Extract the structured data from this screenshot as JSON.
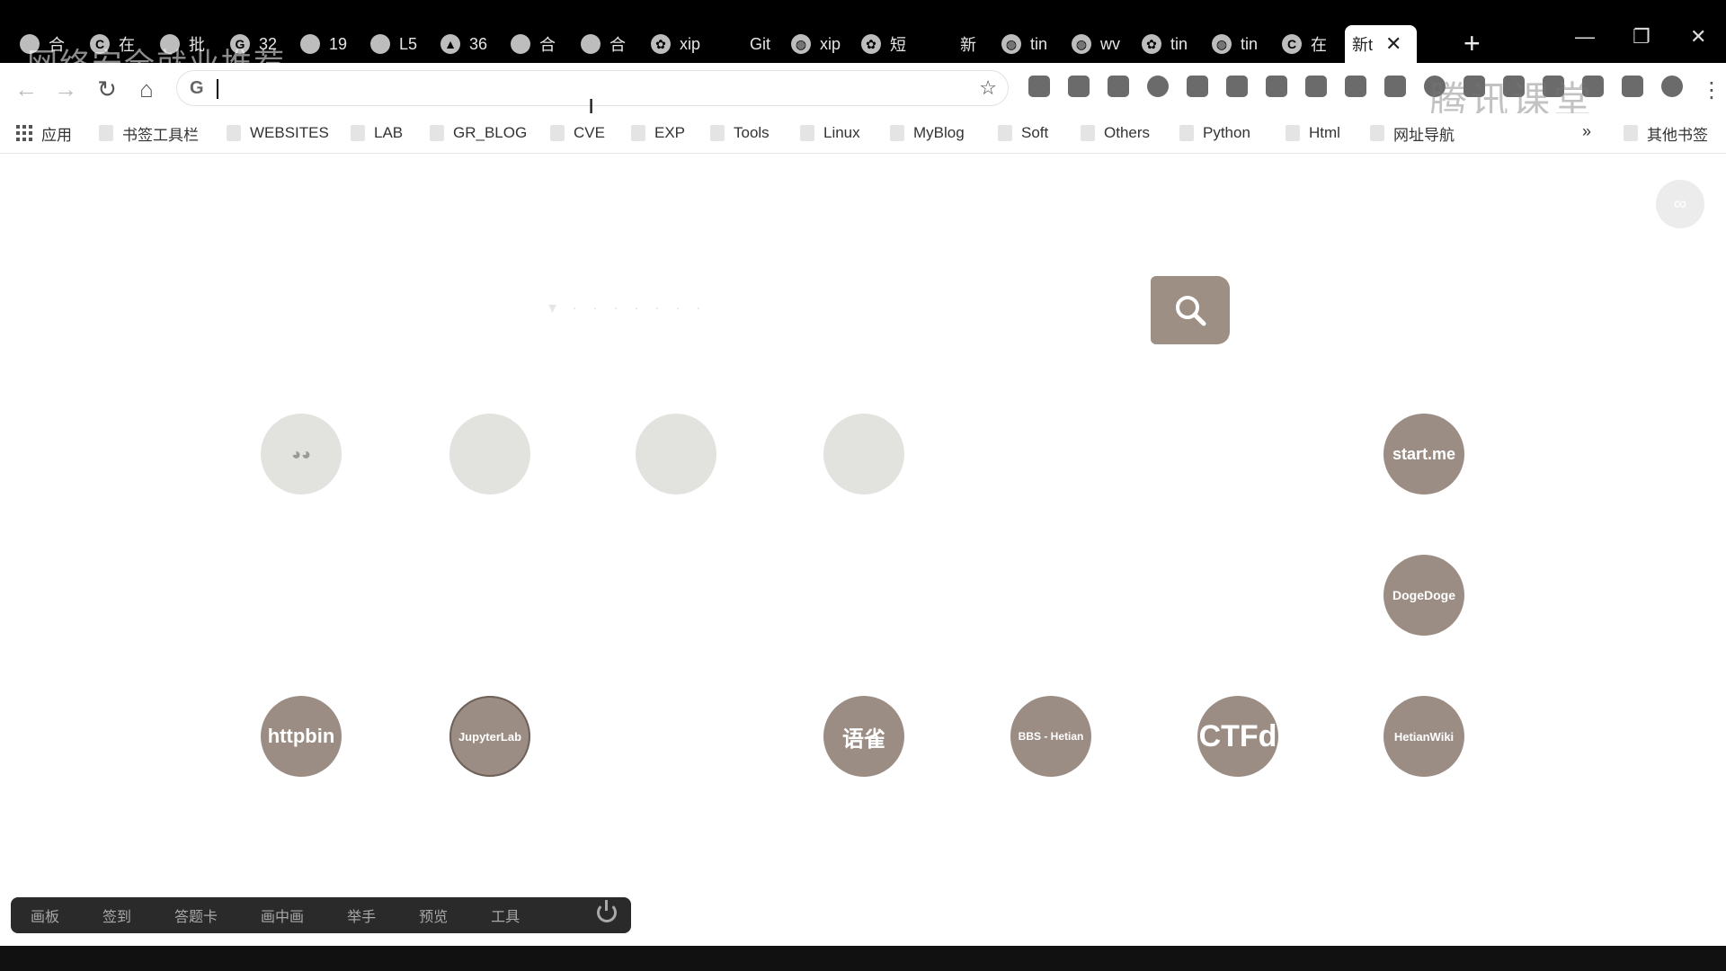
{
  "tabs": [
    {
      "label": "合",
      "icon": "shield-icon"
    },
    {
      "label": "在",
      "icon": "c-icon"
    },
    {
      "label": "批",
      "icon": "shield-icon"
    },
    {
      "label": "32",
      "icon": "g-icon"
    },
    {
      "label": "19",
      "icon": "shield-icon"
    },
    {
      "label": "L5",
      "icon": "shield-icon"
    },
    {
      "label": "36",
      "icon": "triangle-icon"
    },
    {
      "label": "合",
      "icon": "shield-icon"
    },
    {
      "label": "合",
      "icon": "shield-icon"
    },
    {
      "label": "xip",
      "icon": "paw-icon"
    },
    {
      "label": "Git",
      "icon": "blank-icon"
    },
    {
      "label": "xip",
      "icon": "globe-icon"
    },
    {
      "label": "短",
      "icon": "paw-icon"
    },
    {
      "label": "新",
      "icon": "blank-icon"
    },
    {
      "label": "tin",
      "icon": "globe-icon"
    },
    {
      "label": "wv",
      "icon": "globe-icon"
    },
    {
      "label": "tin",
      "icon": "paw-icon"
    },
    {
      "label": "tin",
      "icon": "globe-icon"
    },
    {
      "label": "在",
      "icon": "c-icon"
    }
  ],
  "active_tab": {
    "label": "新t",
    "close": "✕"
  },
  "new_tab": "+",
  "window_controls": {
    "minimize": "—",
    "restore": "❐",
    "close": "✕"
  },
  "watermark_top": "网络安全就业推荐",
  "watermark_right": "腾讯课堂",
  "omnibox": {
    "engine": "G",
    "star": "☆",
    "value": ""
  },
  "nav": {
    "back": "←",
    "forward": "→",
    "reload": "↻",
    "home": "⌂"
  },
  "bookmarks": {
    "apps": "应用",
    "items": [
      "书签工具栏",
      "WEBSITES",
      "LAB",
      "GR_BLOG",
      "CVE",
      "EXP",
      "Tools",
      "Linux",
      "MyBlog",
      "Soft",
      "Others",
      "Python",
      "Html",
      "网址导航"
    ],
    "overflow": "»",
    "other": "其他书签"
  },
  "search": {
    "hint": "▾  · · · · · · ·"
  },
  "tiles": [
    {
      "label": "◕◕",
      "style": "light"
    },
    {
      "label": "",
      "style": "light"
    },
    {
      "label": "",
      "style": "light"
    },
    {
      "label": "",
      "style": "light"
    },
    {
      "label": "start.me",
      "style": "dark"
    },
    {
      "label": "DogeDoge",
      "style": "dark"
    },
    {
      "label": "httpbin",
      "style": "dark"
    },
    {
      "label": "JupyterLab",
      "style": "dark"
    },
    {
      "label": "语雀",
      "style": "dark"
    },
    {
      "label": "BBS - Hetian",
      "style": "dark"
    },
    {
      "label": "CTFd",
      "style": "dark"
    },
    {
      "label": "HetianWiki",
      "style": "dark"
    }
  ],
  "bottom_toolbar": {
    "items": [
      "画板",
      "签到",
      "答题卡",
      "画中画",
      "举手",
      "预览",
      "工具"
    ]
  },
  "colors": {
    "tile_dark": "#9b8d84",
    "tile_light": "#e2e2de",
    "search_button": "#9d8f84"
  }
}
